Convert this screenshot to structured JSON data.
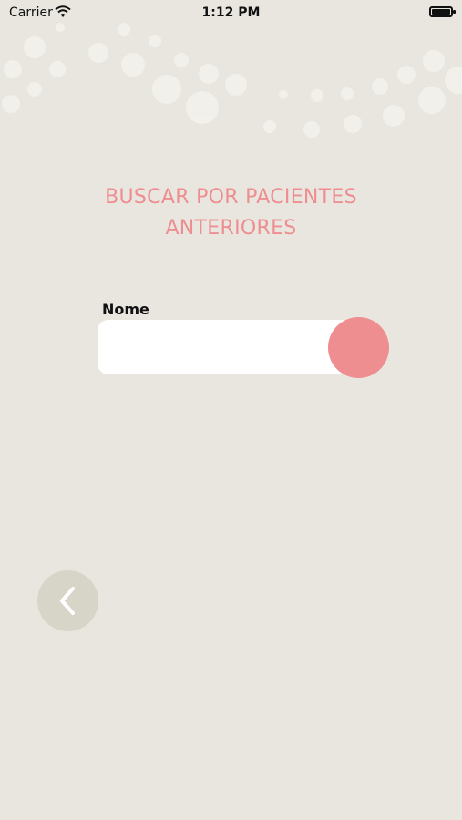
{
  "status_bar": {
    "carrier": "Carrier",
    "time": "1:12 PM"
  },
  "screen": {
    "title_line1": "BUSCAR POR PACIENTES",
    "title_line2": "ANTERIORES"
  },
  "form": {
    "name_label": "Nome",
    "name_value": "",
    "name_placeholder": ""
  },
  "icons": {
    "search_button": "search-button",
    "back": "chevron-left-icon",
    "wifi": "wifi-icon",
    "battery": "battery-icon"
  },
  "colors": {
    "background": "#e8e6df",
    "accent": "#ef8e91",
    "back_button": "#d7d4c8"
  }
}
